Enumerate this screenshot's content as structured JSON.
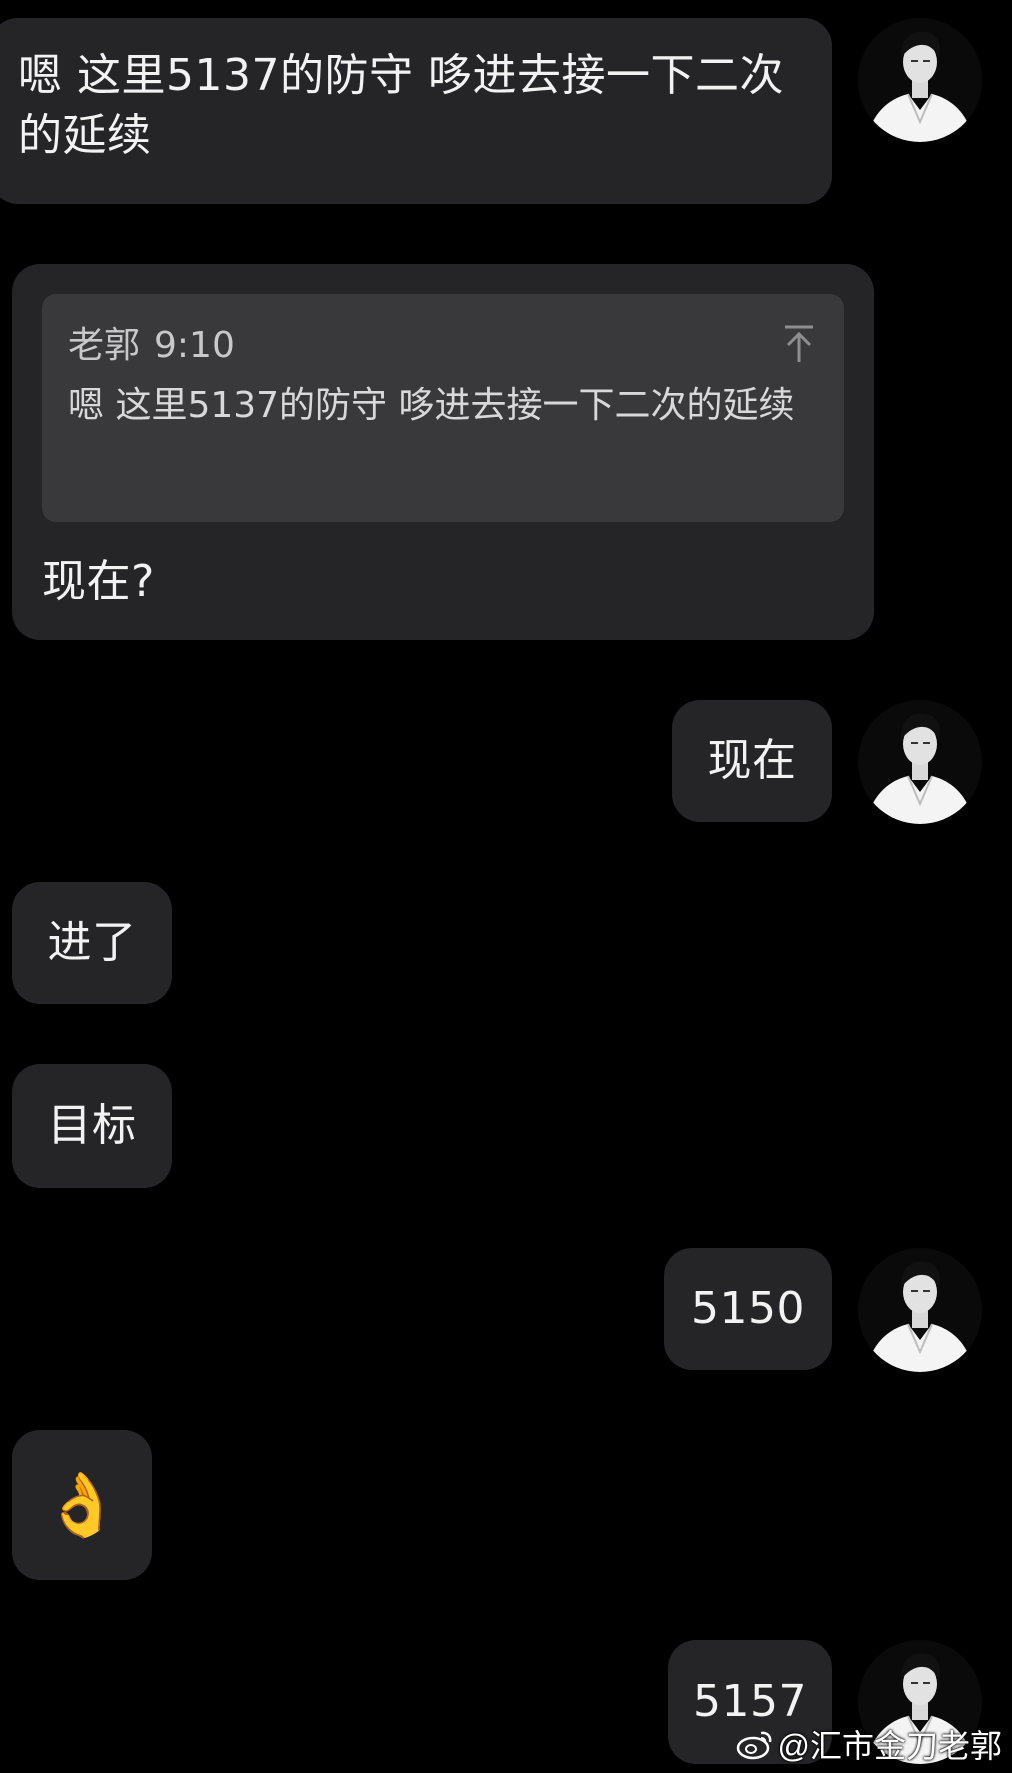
{
  "messages": [
    {
      "text": "嗯  这里5137的防守 哆进去接一下二次的延续"
    },
    {
      "quote": {
        "author": "老郭",
        "time": "9:10",
        "text": "嗯  这里5137的防守 哆进去接一下二次的延续"
      },
      "text": "现在?"
    },
    {
      "text": "现在"
    },
    {
      "text": "进了"
    },
    {
      "text": "目标"
    },
    {
      "text": "5150"
    },
    {
      "text": "👌"
    },
    {
      "text": "5157"
    }
  ],
  "watermark": {
    "icon": "weibo-icon",
    "text": "@汇市金刀老郭"
  },
  "colors": {
    "background": "#000000",
    "bubble": "#252527",
    "quote_card": "#39393b",
    "text": "#f2f2f2"
  }
}
